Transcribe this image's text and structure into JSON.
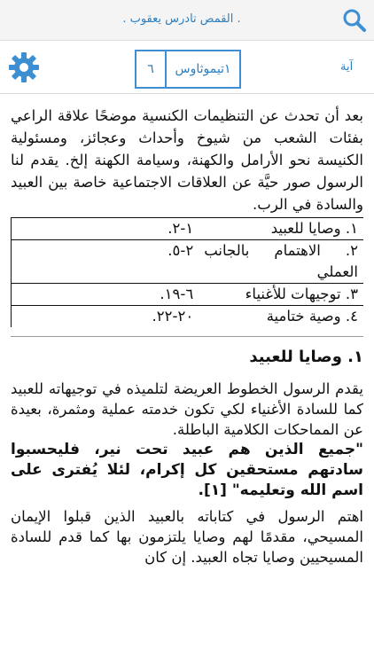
{
  "top_bar": {
    "title": ". القمص تادرس يعقوب ."
  },
  "nav_bar": {
    "verse_label": "آية",
    "book": "١تيموثاوس",
    "chapter": "٦"
  },
  "content": {
    "intro": "بعد أن تحدث عن التنظيمات الكنسية موضحًا علاقة الراعي بفئات الشعب من شيوخ وأحداث وعجائز، ومسئولية الكنيسة نحو الأرامل والكهنة، وسيامة الكهنة إلخ. يقدم لنا الرسول صور حيَّة عن العلاقات الاجتماعية خاصة بين العبيد والسادة في الرب.",
    "outline": [
      {
        "title": "١. وصايا للعبيد",
        "range": "١-٢."
      },
      {
        "title": "٢. الاهتمام بالجانب العملي",
        "range": "٢-٥."
      },
      {
        "title": "٣. توجيهات للأغنياء",
        "range": "٦-١٩."
      },
      {
        "title": "٤. وصية ختامية",
        "range": "٢٠-٢٢."
      }
    ],
    "section_heading": "١. وصايا للعبيد",
    "paragraph1": "يقدم الرسول الخطوط العريضة لتلميذه في توجيهاته للعبيد كما للسادة الأغنياء لكي تكون خدمته عملية ومثمرة، بعيدة عن المماحكات الكلامية الباطلة.",
    "quote": "\"جميع الذين هم عبيد تحت نير، فليحسبوا سادتهم مستحقين كل إكرام، لئلا يُفترى على اسم الله وتعليمه\" [١].",
    "paragraph2": "اهتم الرسول في كتاباته بالعبيد الذين قبلوا الإيمان المسيحي، مقدمًا لهم وصايا يلتزمون بها كما قدم للسادة المسيحيين وصايا تجاه العبيد. إن كان"
  },
  "colors": {
    "accent": "#3d8fd1",
    "link_text": "#2a7fc1"
  }
}
